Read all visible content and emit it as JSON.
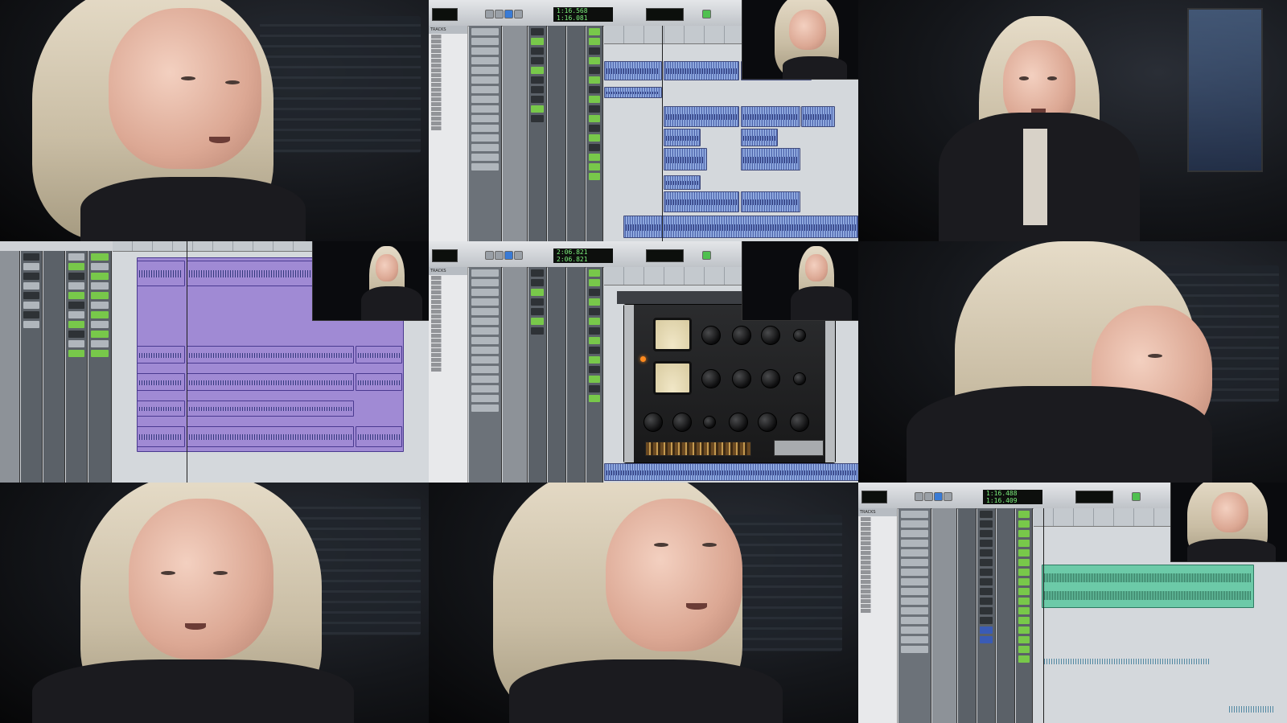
{
  "daw": {
    "top": {
      "counter_main": "1:16.568",
      "counter_sub": "1:16.081"
    },
    "middle": {
      "counter_main": "2:06.821",
      "counter_sub": "2:06.821"
    },
    "bottom": {
      "counter_main": "1:16.488",
      "counter_sub": "1:16.409"
    },
    "tracks_header": "TRACKS"
  },
  "colors": {
    "clip_blue": "#7f9bd8",
    "clip_purple": "#a08ad4",
    "clip_green": "#6ccaa8",
    "counter_text": "#7cf07c",
    "lamp": "#ff8a1e"
  }
}
